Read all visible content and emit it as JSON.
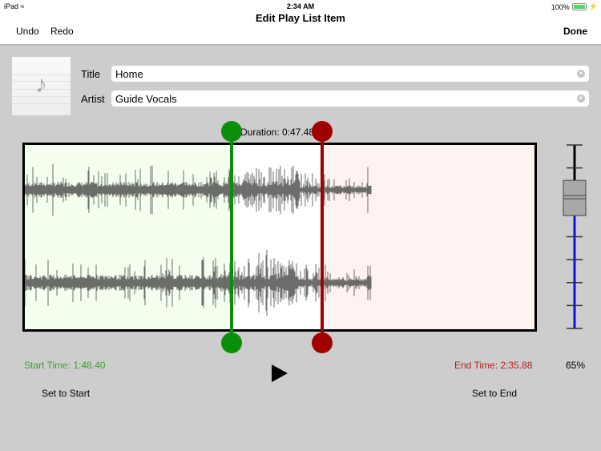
{
  "status_bar": {
    "device": "iPad",
    "wifi_icon": "wifi-icon",
    "time": "2:34 AM",
    "battery": "100%",
    "battery_icon": "battery-charging-icon"
  },
  "nav": {
    "title": "Edit Play List Item",
    "undo_label": "Undo",
    "redo_label": "Redo",
    "done_label": "Done"
  },
  "item": {
    "artwork_icon": "music-note-icon",
    "title_label": "Title",
    "title_value": "Home",
    "artist_label": "Artist",
    "artist_value": "Guide Vocals",
    "clear_icon": "clear-text-icon"
  },
  "editor": {
    "duration": "Duration: 0:47.48",
    "start_time": "Start Time: 1:48.40",
    "end_time": "End Time: 2:35.88",
    "set_start_label": "Set to Start",
    "set_end_label": "Set to End",
    "play_icon": "play-icon",
    "volume_percent": "65%",
    "volume_fraction": 0.65,
    "selection_start_fraction": 0.405,
    "selection_end_fraction": 0.583,
    "audio_end_fraction": 0.68,
    "colors": {
      "start": "#0a8f0a",
      "end": "#a00000",
      "start_region": "#f4fff0",
      "end_region": "#fff3f1",
      "volume": "#1010e6"
    }
  }
}
